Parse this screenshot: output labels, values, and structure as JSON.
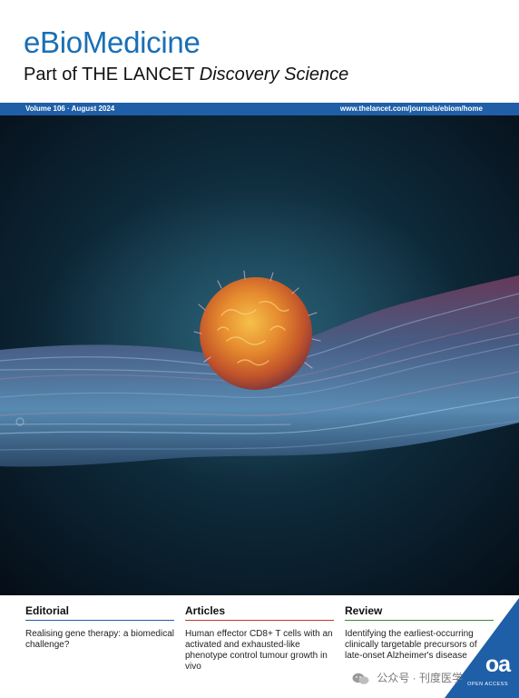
{
  "masthead": {
    "title": "eBioMedicine",
    "subtitle_main": "Part of THE LANCET",
    "subtitle_italic": "Discovery Science"
  },
  "info_bar": {
    "issue": "Volume 106 · August 2024",
    "url": "www.thelancet.com/journals/ebiom/home"
  },
  "sections": [
    {
      "heading": "Editorial",
      "text": "Realising gene therapy: a biomedical challenge?"
    },
    {
      "heading": "Articles",
      "text": "Human effector CD8+ T cells with an activated and exhausted-like phenotype control tumour growth in vivo"
    },
    {
      "heading": "Review",
      "text": "Identifying the earliest-occurring clinically targetable precursors of late-onset Alzheimer's disease"
    }
  ],
  "oa_badge": {
    "label": "oa",
    "sub": "OPEN ACCESS"
  },
  "watermark": {
    "text": "公众号 · 刊度医学"
  },
  "colors": {
    "brand_blue": "#1a6fb5",
    "bar_blue": "#1f5fa8",
    "articles_red": "#c0392b",
    "review_green": "#3a8a3a"
  },
  "icons": {
    "watermark": "wechat-icon"
  }
}
